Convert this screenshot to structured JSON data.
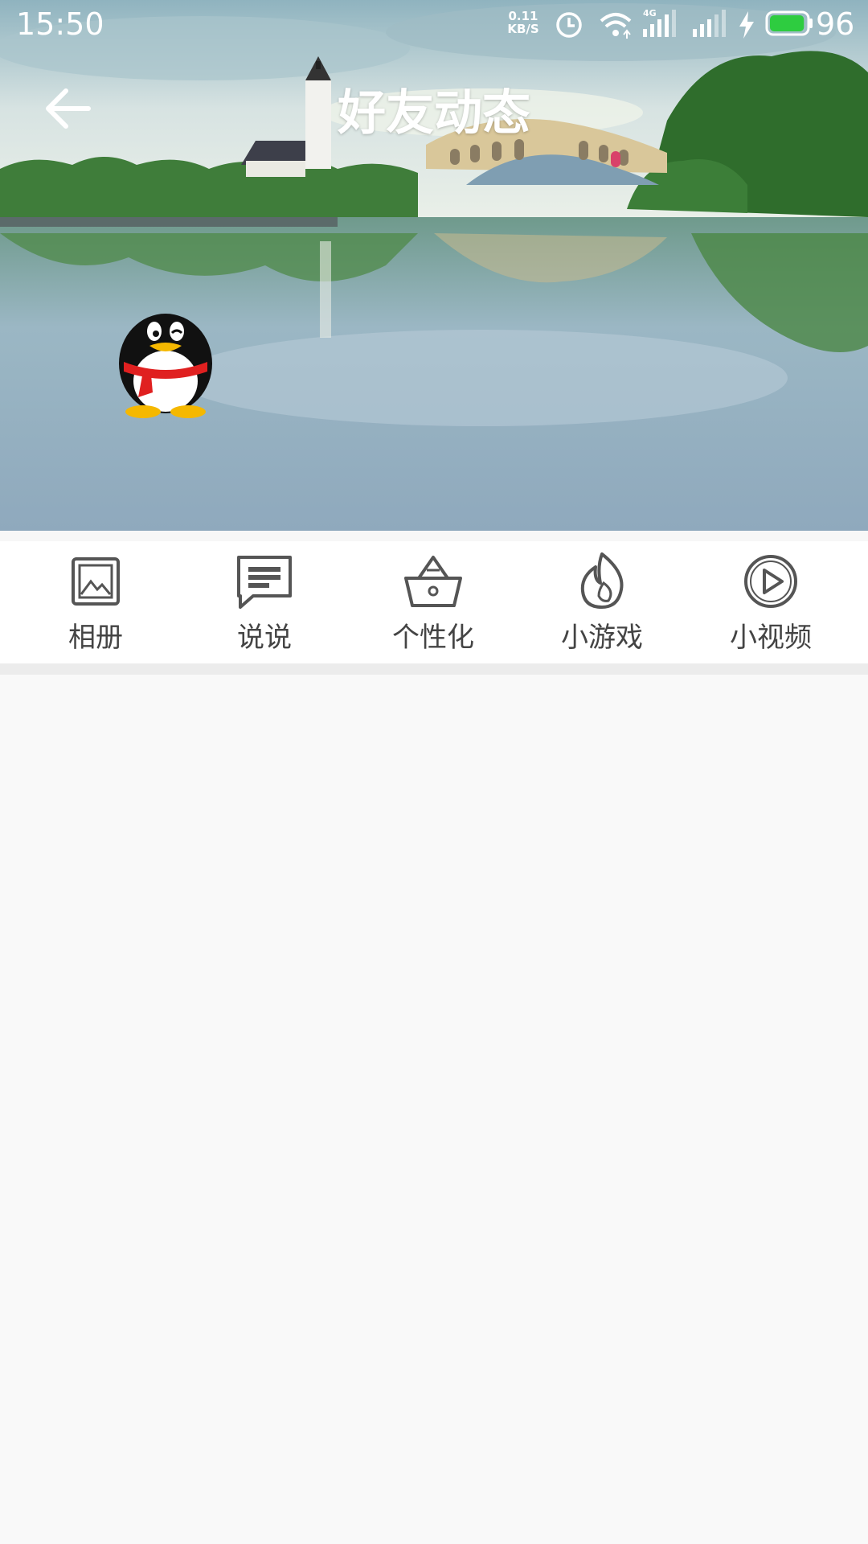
{
  "status_bar": {
    "time": "15:50",
    "net_speed_value": "0.11",
    "net_speed_unit": "KB/S",
    "network_type": "4G",
    "battery_level": "96",
    "battery_color": "#2ecc40"
  },
  "header": {
    "title": "好友动态",
    "back_icon": "arrow-left-icon",
    "avatar_icon": "qq-penguin-icon"
  },
  "shortcuts": [
    {
      "label": "相册",
      "icon": "photo-album-icon"
    },
    {
      "label": "说说",
      "icon": "chat-bubble-icon"
    },
    {
      "label": "个性化",
      "icon": "basket-icon"
    },
    {
      "label": "小游戏",
      "icon": "flame-icon"
    },
    {
      "label": "小视频",
      "icon": "play-circle-icon"
    }
  ],
  "colors": {
    "icon_stroke": "#555555",
    "label_text": "#444444",
    "divider": "#ececec",
    "content_bg": "#f9f9f9"
  }
}
